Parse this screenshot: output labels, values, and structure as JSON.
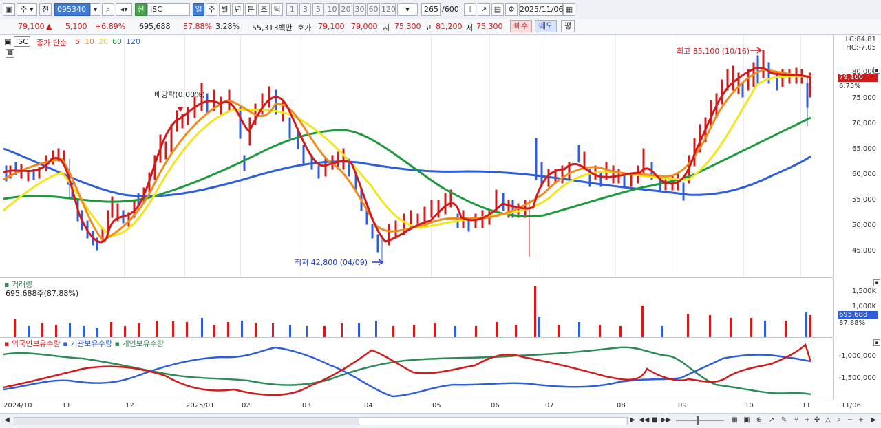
{
  "toolbar": {
    "period_select": "주",
    "prev_label": "전",
    "code": "095340",
    "stock_badge": "신",
    "stock_name": "ISC",
    "period_tabs": [
      "일",
      "주",
      "월",
      "년",
      "분",
      "초",
      "틱"
    ],
    "tick_values": [
      "1",
      "3",
      "5",
      "10",
      "20",
      "30",
      "60",
      "120"
    ],
    "count_value": "265",
    "count_total": "/600",
    "date_value": "2025/11/06"
  },
  "quote": {
    "price": "79,100",
    "change_arrow": "▲",
    "change": "5,100",
    "change_pct": "+6.89%",
    "volume": "695,688",
    "volume_ratio": "87.88%",
    "turnover": "3.28%",
    "amount": "55,313백만",
    "bid_label": "호가",
    "bid": "79,100",
    "ask": "79,000",
    "open_label": "시",
    "open": "75,300",
    "high_label": "고",
    "high": "81,200",
    "low_label": "저",
    "low": "75,300",
    "buy_button": "매수",
    "sell_button": "매도",
    "eval_button": "평"
  },
  "price_pane": {
    "ticker": "ISC",
    "legend_prefix": "종가 단순",
    "ma_periods": [
      "5",
      "10",
      "20",
      "60",
      "120"
    ],
    "ma_colors": [
      "#d21b1b",
      "#f08c1e",
      "#f2e61a",
      "#1e9a3c",
      "#2f5fd8"
    ],
    "lc_label": "LC:84.81",
    "hc_label": "HC:-7.05",
    "y_labels": [
      "80,000",
      "75,000",
      "70,000",
      "65,000",
      "60,000",
      "55,000",
      "50,000",
      "45,000"
    ],
    "current_price": "79,100",
    "current_pct": "6.75%",
    "high_annotation": "최고 85,100 (10/16)",
    "low_annotation": "최저 42,800 (04/09)",
    "dividend_annotation": "배당락(0.00%)"
  },
  "volume_pane": {
    "title": "거래량",
    "subtitle": "695,688주(87.88%)",
    "y_labels": [
      "1,500K",
      "1,000K"
    ],
    "current_volume": "695,688",
    "current_pct": "87.88%"
  },
  "holdings_pane": {
    "legend": [
      "외국인보유수량",
      "기관보유수량",
      "개인보유수량"
    ],
    "legend_colors": [
      "#d21b1b",
      "#2f5fd8",
      "#2e8b57"
    ],
    "y_labels": [
      "-1,000,000",
      "-1,500,000"
    ]
  },
  "x_axis": {
    "labels": [
      "2024/10",
      "11",
      "12",
      "2025/01",
      "02",
      "03",
      "04",
      "05",
      "06",
      "07",
      "08",
      "09",
      "10",
      "11"
    ],
    "end_label": "11/06"
  }
}
